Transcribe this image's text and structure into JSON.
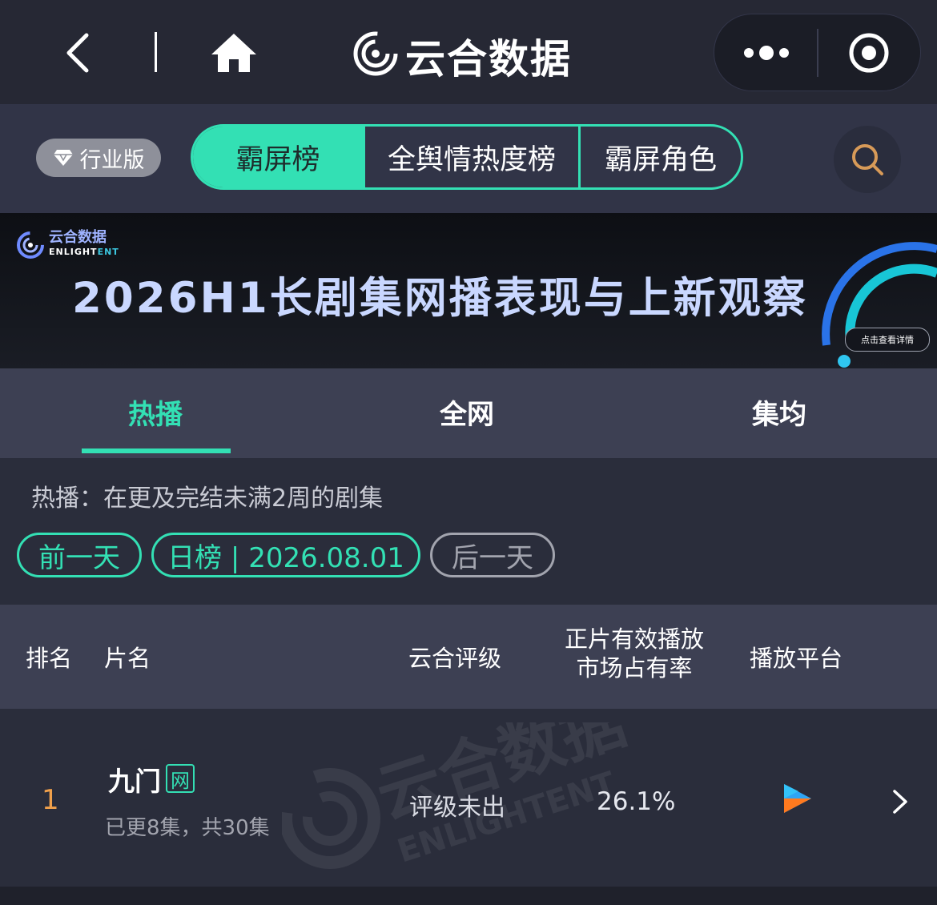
{
  "nav": {
    "app_title": "云合数据"
  },
  "filter": {
    "industry_label": "行业版",
    "segments": [
      "霸屏榜",
      "全舆情热度榜",
      "霸屏角色"
    ],
    "active_segment": 0
  },
  "banner": {
    "brand_cn": "云合数据",
    "brand_en_a": "ENLIGHT",
    "brand_en_b": "ENT",
    "title": "2026H1长剧集网播表现与上新观察",
    "cta": "点击查看详情"
  },
  "tabs": [
    "热播",
    "全网",
    "集均"
  ],
  "description": "热播：在更及完结未满2周的剧集",
  "date_nav": {
    "prev": "前一天",
    "current": "日榜 | 2026.08.01",
    "next": "后一天"
  },
  "table": {
    "headers": {
      "rank": "排名",
      "title": "片名",
      "rating": "云合评级",
      "share_line1": "正片有效播放",
      "share_line2": "市场占有率",
      "platform": "播放平台"
    },
    "rows": [
      {
        "rank": "1",
        "title": "九门",
        "badge": "网",
        "episodes": "已更8集，共30集",
        "rating": "评级未出",
        "share": "26.1%"
      }
    ]
  },
  "colors": {
    "accent": "#33e0b4",
    "rank": "#f0a04b",
    "background": "#2a2d3b",
    "header_bg": "#3d4053"
  }
}
